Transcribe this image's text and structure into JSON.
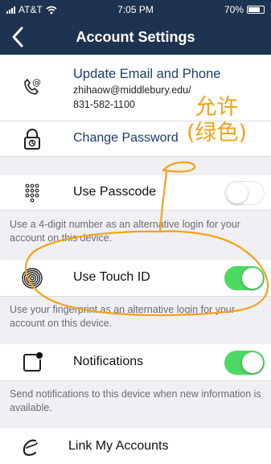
{
  "status_bar": {
    "carrier": "AT&T",
    "time": "7:05 PM",
    "battery": "70%"
  },
  "nav": {
    "title": "Account Settings"
  },
  "update_contact": {
    "label": "Update Email and Phone",
    "email": "zhihaow@middlebury.edu/",
    "phone": "831-582-1100"
  },
  "change_password": {
    "label": "Change Password"
  },
  "passcode": {
    "label": "Use Passcode",
    "enabled": false,
    "description": "Use a 4-digit number as an alternative login for your account on this device."
  },
  "touch_id": {
    "label": "Use Touch ID",
    "enabled": true,
    "description": "Use your fingerprint as an alternative login for your account on this device."
  },
  "notifications": {
    "label": "Notifications",
    "enabled": true,
    "description": "Send notifications to this device when new information is available."
  },
  "link_accounts": {
    "label": "Link My Accounts"
  },
  "annotation": {
    "line1": "允许",
    "line2": "(绿色)",
    "color": "#f2a316"
  },
  "colors": {
    "nav_bg": "#1e3350",
    "link": "#1e3d6b",
    "toggle_on": "#4cd964"
  }
}
